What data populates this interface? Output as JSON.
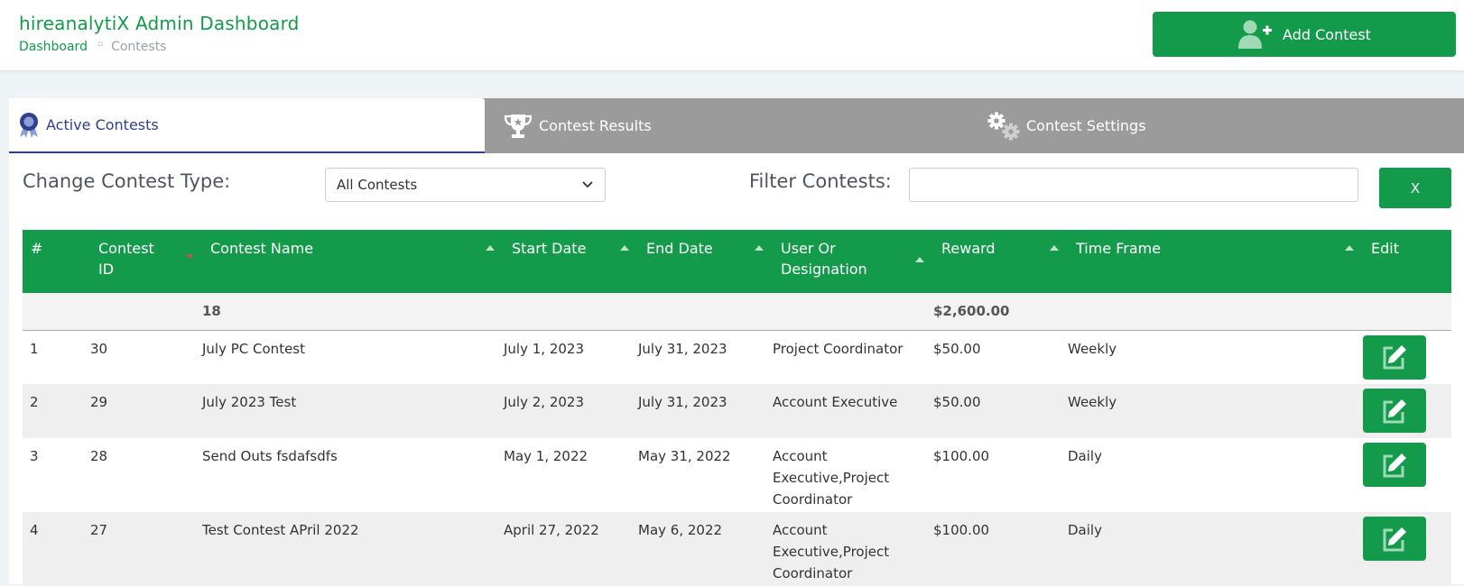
{
  "header": {
    "title": "hireanalytiX Admin Dashboard",
    "breadcrumb": {
      "home": "Dashboard",
      "separator": "▫",
      "current": "Contests"
    },
    "add_button_label": "Add Contest"
  },
  "tabs": [
    {
      "label": "Active Contests",
      "icon": "award-ribbon-icon",
      "active": true
    },
    {
      "label": "Contest Results",
      "icon": "trophy-icon",
      "active": false
    },
    {
      "label": "Contest Settings",
      "icon": "gears-icon",
      "active": false
    }
  ],
  "filters": {
    "contest_type_label": "Change Contest Type:",
    "contest_type_value": "All Contests",
    "filter_label": "Filter Contests:",
    "filter_value": "",
    "clear_button_label": "X"
  },
  "table": {
    "columns": [
      {
        "label": "#"
      },
      {
        "label": "Contest ID"
      },
      {
        "label": "Contest Name"
      },
      {
        "label": "Start Date"
      },
      {
        "label": "End Date"
      },
      {
        "label": "User Or Designation"
      },
      {
        "label": "Reward"
      },
      {
        "label": "Time Frame"
      },
      {
        "label": "Edit"
      }
    ],
    "summary": {
      "count": "18",
      "reward_total": "$2,600.00"
    },
    "rows": [
      {
        "num": "1",
        "id": "30",
        "name": "July PC Contest",
        "start": "July 1, 2023",
        "end": "July 31, 2023",
        "designation": "Project Coordinator",
        "reward": "$50.00",
        "timeframe": "Weekly"
      },
      {
        "num": "2",
        "id": "29",
        "name": "July 2023 Test",
        "start": "July 2, 2023",
        "end": "July 31, 2023",
        "designation": "Account Executive",
        "reward": "$50.00",
        "timeframe": "Weekly"
      },
      {
        "num": "3",
        "id": "28",
        "name": "Send Outs fsdafsdfs",
        "start": "May 1, 2022",
        "end": "May 31, 2022",
        "designation": "Account Executive,Project Coordinator",
        "reward": "$100.00",
        "timeframe": "Daily"
      },
      {
        "num": "4",
        "id": "27",
        "name": "Test Contest APril 2022",
        "start": "April 27, 2022",
        "end": "May 6, 2022",
        "designation": "Account Executive,Project Coordinator",
        "reward": "$100.00",
        "timeframe": "Daily"
      }
    ]
  },
  "colors": {
    "brand_green": "#139a4a",
    "tab_active_text": "#2d3f8f",
    "tab_bar_gray": "#9b9b9b"
  }
}
